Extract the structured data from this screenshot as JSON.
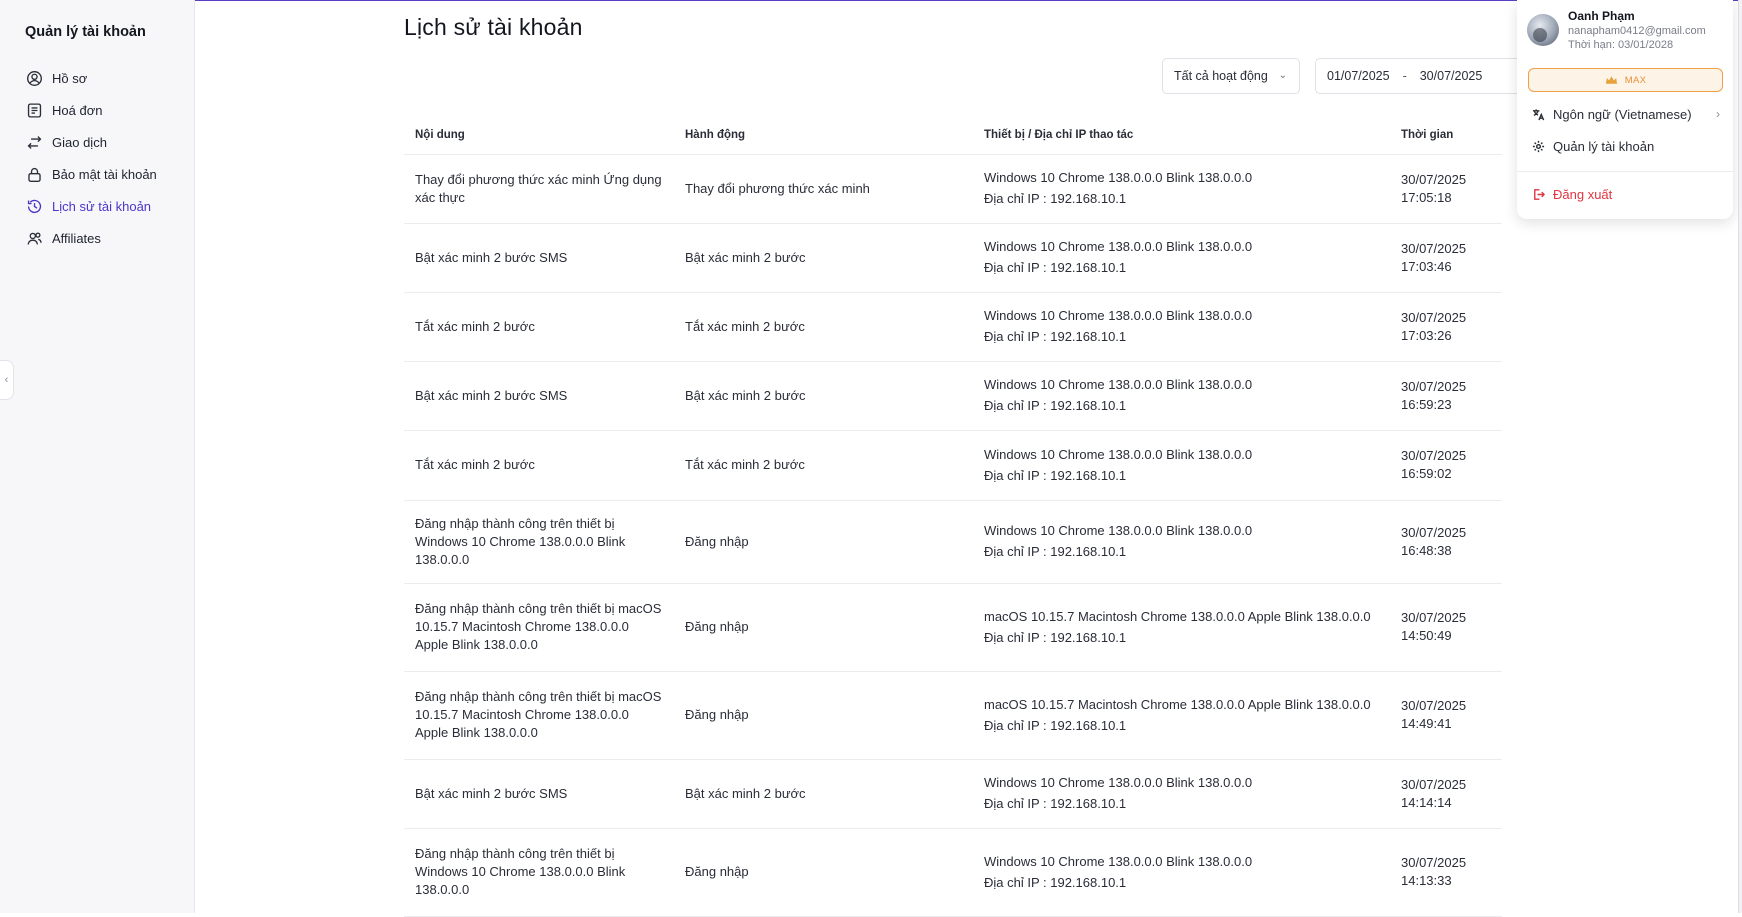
{
  "sidebar": {
    "title": "Quản lý tài khoản",
    "items": [
      {
        "label": "Hồ sơ",
        "icon": "user-circle-icon"
      },
      {
        "label": "Hoá đơn",
        "icon": "invoice-icon"
      },
      {
        "label": "Giao dịch",
        "icon": "transfer-icon"
      },
      {
        "label": "Bảo mật tài khoản",
        "icon": "lock-icon"
      },
      {
        "label": "Lịch sử tài khoản",
        "icon": "history-icon",
        "active": true
      },
      {
        "label": "Affiliates",
        "icon": "users-icon"
      }
    ]
  },
  "main": {
    "title": "Lịch sử tài khoản",
    "filter": {
      "selected": "Tất cả hoạt động"
    },
    "date_range": {
      "from": "01/07/2025",
      "separator": "-",
      "to": "30/07/2025"
    },
    "table": {
      "headers": [
        "Nội dung",
        "Hành động",
        "Thiết bị / Địa chỉ IP thao tác",
        "Thời gian"
      ],
      "rows": [
        {
          "content": "Thay đổi phương thức xác minh Ứng dụng xác thực",
          "action": "Thay đổi phương thức xác minh",
          "device": "Windows 10 Chrome 138.0.0.0 Blink 138.0.0.0",
          "ip": "Địa chỉ IP : 192.168.10.1",
          "date": "30/07/2025",
          "time": "17:05:18"
        },
        {
          "content": "Bật xác minh 2 bước SMS",
          "action": "Bật xác minh 2 bước",
          "device": "Windows 10 Chrome 138.0.0.0 Blink 138.0.0.0",
          "ip": "Địa chỉ IP : 192.168.10.1",
          "date": "30/07/2025",
          "time": "17:03:46"
        },
        {
          "content": "Tắt xác minh 2 bước",
          "action": "Tắt xác minh 2 bước",
          "device": "Windows 10 Chrome 138.0.0.0 Blink 138.0.0.0",
          "ip": "Địa chỉ IP : 192.168.10.1",
          "date": "30/07/2025",
          "time": "17:03:26"
        },
        {
          "content": "Bật xác minh 2 bước SMS",
          "action": "Bật xác minh 2 bước",
          "device": "Windows 10 Chrome 138.0.0.0 Blink 138.0.0.0",
          "ip": "Địa chỉ IP : 192.168.10.1",
          "date": "30/07/2025",
          "time": "16:59:23"
        },
        {
          "content": "Tắt xác minh 2 bước",
          "action": "Tắt xác minh 2 bước",
          "device": "Windows 10 Chrome 138.0.0.0 Blink 138.0.0.0",
          "ip": "Địa chỉ IP : 192.168.10.1",
          "date": "30/07/2025",
          "time": "16:59:02"
        },
        {
          "content": "Đăng nhập thành công trên thiết bị Windows 10 Chrome 138.0.0.0 Blink 138.0.0.0",
          "action": "Đăng nhập",
          "device": "Windows 10 Chrome 138.0.0.0 Blink 138.0.0.0",
          "ip": "Địa chỉ IP : 192.168.10.1",
          "date": "30/07/2025",
          "time": "16:48:38"
        },
        {
          "content": "Đăng nhập thành công trên thiết bị macOS 10.15.7 Macintosh Chrome 138.0.0.0 Apple Blink 138.0.0.0",
          "action": "Đăng nhập",
          "device": "macOS 10.15.7 Macintosh Chrome 138.0.0.0 Apple Blink 138.0.0.0",
          "ip": "Địa chỉ IP : 192.168.10.1",
          "date": "30/07/2025",
          "time": "14:50:49"
        },
        {
          "content": "Đăng nhập thành công trên thiết bị macOS 10.15.7 Macintosh Chrome 138.0.0.0 Apple Blink 138.0.0.0",
          "action": "Đăng nhập",
          "device": "macOS 10.15.7 Macintosh Chrome 138.0.0.0 Apple Blink 138.0.0.0",
          "ip": "Địa chỉ IP : 192.168.10.1",
          "date": "30/07/2025",
          "time": "14:49:41"
        },
        {
          "content": "Bật xác minh 2 bước SMS",
          "action": "Bật xác minh 2 bước",
          "device": "Windows 10 Chrome 138.0.0.0 Blink 138.0.0.0",
          "ip": "Địa chỉ IP : 192.168.10.1",
          "date": "30/07/2025",
          "time": "14:14:14"
        },
        {
          "content": "Đăng nhập thành công trên thiết bị Windows 10 Chrome 138.0.0.0 Blink 138.0.0.0",
          "action": "Đăng nhập",
          "device": "Windows 10 Chrome 138.0.0.0 Blink 138.0.0.0",
          "ip": "Địa chỉ IP : 192.168.10.1",
          "date": "30/07/2025",
          "time": "14:13:33"
        }
      ]
    }
  },
  "user_menu": {
    "name": "Oanh Phạm",
    "email": "nanapham0412@gmail.com",
    "expiry": "Thời hạn: 03/01/2028",
    "plan": "MAX",
    "language": "Ngôn ngữ (Vietnamese)",
    "manage": "Quản lý tài khoản",
    "logout": "Đăng xuất"
  },
  "colors": {
    "accent": "#4a36c9",
    "danger": "#e0353f",
    "plan": "#e8903a"
  }
}
